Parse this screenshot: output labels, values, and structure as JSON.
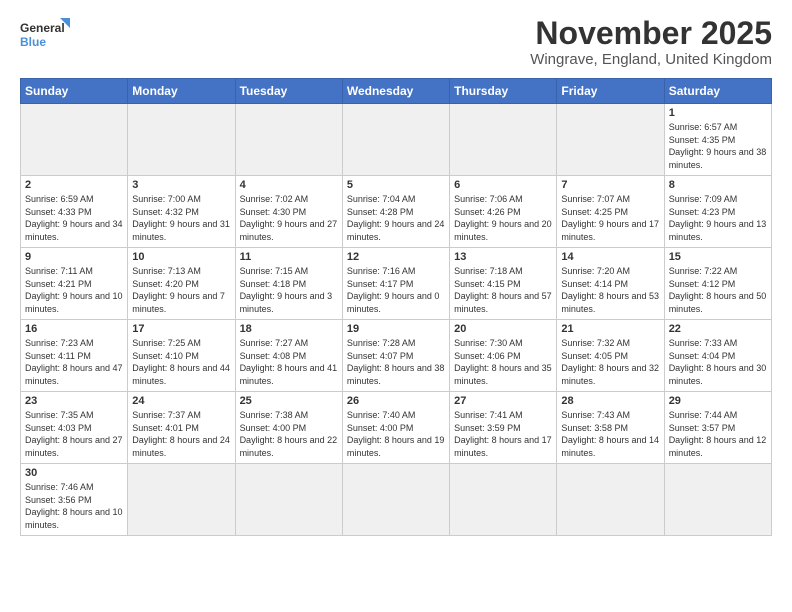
{
  "header": {
    "logo_general": "General",
    "logo_blue": "Blue",
    "title": "November 2025",
    "subtitle": "Wingrave, England, United Kingdom"
  },
  "days_of_week": [
    "Sunday",
    "Monday",
    "Tuesday",
    "Wednesday",
    "Thursday",
    "Friday",
    "Saturday"
  ],
  "weeks": [
    [
      {
        "day": "",
        "info": "",
        "empty": true
      },
      {
        "day": "",
        "info": "",
        "empty": true
      },
      {
        "day": "",
        "info": "",
        "empty": true
      },
      {
        "day": "",
        "info": "",
        "empty": true
      },
      {
        "day": "",
        "info": "",
        "empty": true
      },
      {
        "day": "",
        "info": "",
        "empty": true
      },
      {
        "day": "1",
        "info": "Sunrise: 6:57 AM\nSunset: 4:35 PM\nDaylight: 9 hours\nand 38 minutes.",
        "empty": false
      }
    ],
    [
      {
        "day": "2",
        "info": "Sunrise: 6:59 AM\nSunset: 4:33 PM\nDaylight: 9 hours\nand 34 minutes.",
        "empty": false
      },
      {
        "day": "3",
        "info": "Sunrise: 7:00 AM\nSunset: 4:32 PM\nDaylight: 9 hours\nand 31 minutes.",
        "empty": false
      },
      {
        "day": "4",
        "info": "Sunrise: 7:02 AM\nSunset: 4:30 PM\nDaylight: 9 hours\nand 27 minutes.",
        "empty": false
      },
      {
        "day": "5",
        "info": "Sunrise: 7:04 AM\nSunset: 4:28 PM\nDaylight: 9 hours\nand 24 minutes.",
        "empty": false
      },
      {
        "day": "6",
        "info": "Sunrise: 7:06 AM\nSunset: 4:26 PM\nDaylight: 9 hours\nand 20 minutes.",
        "empty": false
      },
      {
        "day": "7",
        "info": "Sunrise: 7:07 AM\nSunset: 4:25 PM\nDaylight: 9 hours\nand 17 minutes.",
        "empty": false
      },
      {
        "day": "8",
        "info": "Sunrise: 7:09 AM\nSunset: 4:23 PM\nDaylight: 9 hours\nand 13 minutes.",
        "empty": false
      }
    ],
    [
      {
        "day": "9",
        "info": "Sunrise: 7:11 AM\nSunset: 4:21 PM\nDaylight: 9 hours\nand 10 minutes.",
        "empty": false
      },
      {
        "day": "10",
        "info": "Sunrise: 7:13 AM\nSunset: 4:20 PM\nDaylight: 9 hours\nand 7 minutes.",
        "empty": false
      },
      {
        "day": "11",
        "info": "Sunrise: 7:15 AM\nSunset: 4:18 PM\nDaylight: 9 hours\nand 3 minutes.",
        "empty": false
      },
      {
        "day": "12",
        "info": "Sunrise: 7:16 AM\nSunset: 4:17 PM\nDaylight: 9 hours\nand 0 minutes.",
        "empty": false
      },
      {
        "day": "13",
        "info": "Sunrise: 7:18 AM\nSunset: 4:15 PM\nDaylight: 8 hours\nand 57 minutes.",
        "empty": false
      },
      {
        "day": "14",
        "info": "Sunrise: 7:20 AM\nSunset: 4:14 PM\nDaylight: 8 hours\nand 53 minutes.",
        "empty": false
      },
      {
        "day": "15",
        "info": "Sunrise: 7:22 AM\nSunset: 4:12 PM\nDaylight: 8 hours\nand 50 minutes.",
        "empty": false
      }
    ],
    [
      {
        "day": "16",
        "info": "Sunrise: 7:23 AM\nSunset: 4:11 PM\nDaylight: 8 hours\nand 47 minutes.",
        "empty": false
      },
      {
        "day": "17",
        "info": "Sunrise: 7:25 AM\nSunset: 4:10 PM\nDaylight: 8 hours\nand 44 minutes.",
        "empty": false
      },
      {
        "day": "18",
        "info": "Sunrise: 7:27 AM\nSunset: 4:08 PM\nDaylight: 8 hours\nand 41 minutes.",
        "empty": false
      },
      {
        "day": "19",
        "info": "Sunrise: 7:28 AM\nSunset: 4:07 PM\nDaylight: 8 hours\nand 38 minutes.",
        "empty": false
      },
      {
        "day": "20",
        "info": "Sunrise: 7:30 AM\nSunset: 4:06 PM\nDaylight: 8 hours\nand 35 minutes.",
        "empty": false
      },
      {
        "day": "21",
        "info": "Sunrise: 7:32 AM\nSunset: 4:05 PM\nDaylight: 8 hours\nand 32 minutes.",
        "empty": false
      },
      {
        "day": "22",
        "info": "Sunrise: 7:33 AM\nSunset: 4:04 PM\nDaylight: 8 hours\nand 30 minutes.",
        "empty": false
      }
    ],
    [
      {
        "day": "23",
        "info": "Sunrise: 7:35 AM\nSunset: 4:03 PM\nDaylight: 8 hours\nand 27 minutes.",
        "empty": false
      },
      {
        "day": "24",
        "info": "Sunrise: 7:37 AM\nSunset: 4:01 PM\nDaylight: 8 hours\nand 24 minutes.",
        "empty": false
      },
      {
        "day": "25",
        "info": "Sunrise: 7:38 AM\nSunset: 4:00 PM\nDaylight: 8 hours\nand 22 minutes.",
        "empty": false
      },
      {
        "day": "26",
        "info": "Sunrise: 7:40 AM\nSunset: 4:00 PM\nDaylight: 8 hours\nand 19 minutes.",
        "empty": false
      },
      {
        "day": "27",
        "info": "Sunrise: 7:41 AM\nSunset: 3:59 PM\nDaylight: 8 hours\nand 17 minutes.",
        "empty": false
      },
      {
        "day": "28",
        "info": "Sunrise: 7:43 AM\nSunset: 3:58 PM\nDaylight: 8 hours\nand 14 minutes.",
        "empty": false
      },
      {
        "day": "29",
        "info": "Sunrise: 7:44 AM\nSunset: 3:57 PM\nDaylight: 8 hours\nand 12 minutes.",
        "empty": false
      }
    ],
    [
      {
        "day": "30",
        "info": "Sunrise: 7:46 AM\nSunset: 3:56 PM\nDaylight: 8 hours\nand 10 minutes.",
        "empty": false
      },
      {
        "day": "",
        "info": "",
        "empty": true
      },
      {
        "day": "",
        "info": "",
        "empty": true
      },
      {
        "day": "",
        "info": "",
        "empty": true
      },
      {
        "day": "",
        "info": "",
        "empty": true
      },
      {
        "day": "",
        "info": "",
        "empty": true
      },
      {
        "day": "",
        "info": "",
        "empty": true
      }
    ]
  ]
}
